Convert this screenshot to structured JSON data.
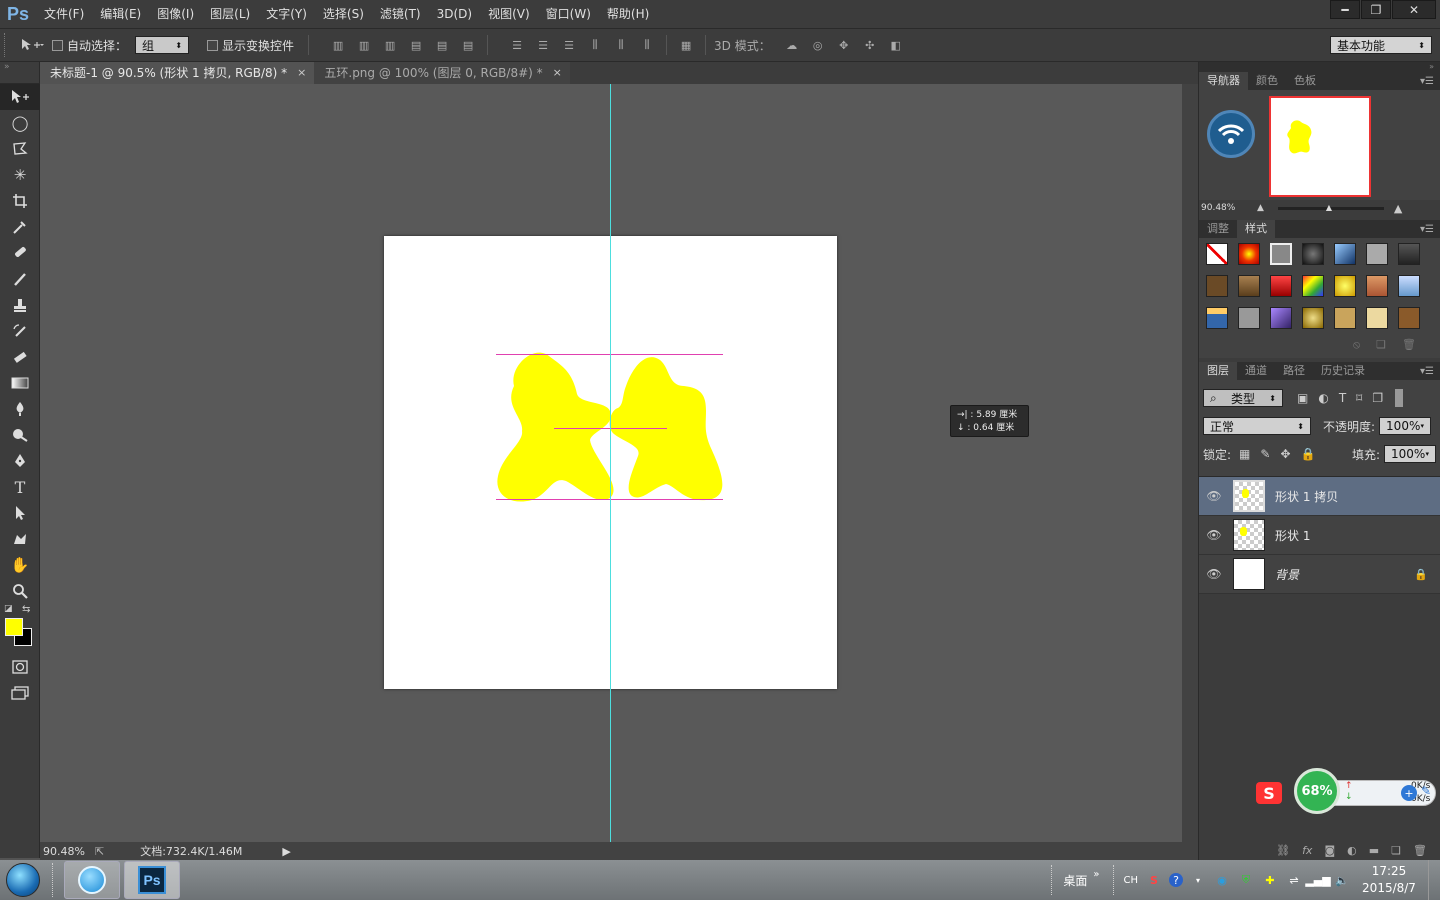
{
  "app": {
    "logo": "Ps"
  },
  "menu": [
    "文件(F)",
    "编辑(E)",
    "图像(I)",
    "图层(L)",
    "文字(Y)",
    "选择(S)",
    "滤镜(T)",
    "3D(D)",
    "视图(V)",
    "窗口(W)",
    "帮助(H)"
  ],
  "window_controls": {
    "minimize": "━",
    "restore": "❐",
    "close": "✕"
  },
  "options": {
    "auto_select_label": "自动选择：",
    "auto_select_value": "组",
    "show_transform_label": "显示变换控件",
    "mode_3d_label": "3D 模式：",
    "workspace": "基本功能"
  },
  "tabs": [
    {
      "title": "未标题-1 @ 90.5% (形状 1 拷贝, RGB/8) *",
      "close": "×"
    },
    {
      "title": "五环.png @ 100% (图层 0, RGB/8#) *",
      "close": "×"
    }
  ],
  "hud": {
    "line1": "→| : 5.89 厘米",
    "line2": "↓ : 0.64 厘米"
  },
  "status": {
    "zoom": "90.48%",
    "doc": "文档:732.4K/1.46M"
  },
  "navigator": {
    "tabs": [
      "导航器",
      "颜色",
      "色板"
    ],
    "zoom": "90.48%"
  },
  "styles_panel": {
    "tabs": [
      "调整",
      "样式"
    ]
  },
  "layers_panel": {
    "tabs": [
      "图层",
      "通道",
      "路径",
      "历史记录"
    ],
    "filter_kind": "类型",
    "blend_mode": "正常",
    "opacity_label": "不透明度:",
    "opacity_value": "100%",
    "lock_label": "锁定:",
    "fill_label": "填充:",
    "fill_value": "100%",
    "layers": [
      {
        "name": "形状 1 拷贝",
        "selected": true
      },
      {
        "name": "形状 1",
        "selected": false
      },
      {
        "name": "背景",
        "selected": false,
        "locked": true
      }
    ]
  },
  "widget": {
    "percent": "68%",
    "up": "0K/s",
    "down": "0K/s",
    "logo": "S"
  },
  "taskbar": {
    "desktop_label": "桌面",
    "lang": "CH",
    "time": "17:25",
    "date": "2015/8/7"
  },
  "colors": {
    "foreground": "#ffff00",
    "background": "#000000",
    "guide": "#4ddede",
    "shape": "#ffff00",
    "smart_guide": "#e040b0"
  }
}
